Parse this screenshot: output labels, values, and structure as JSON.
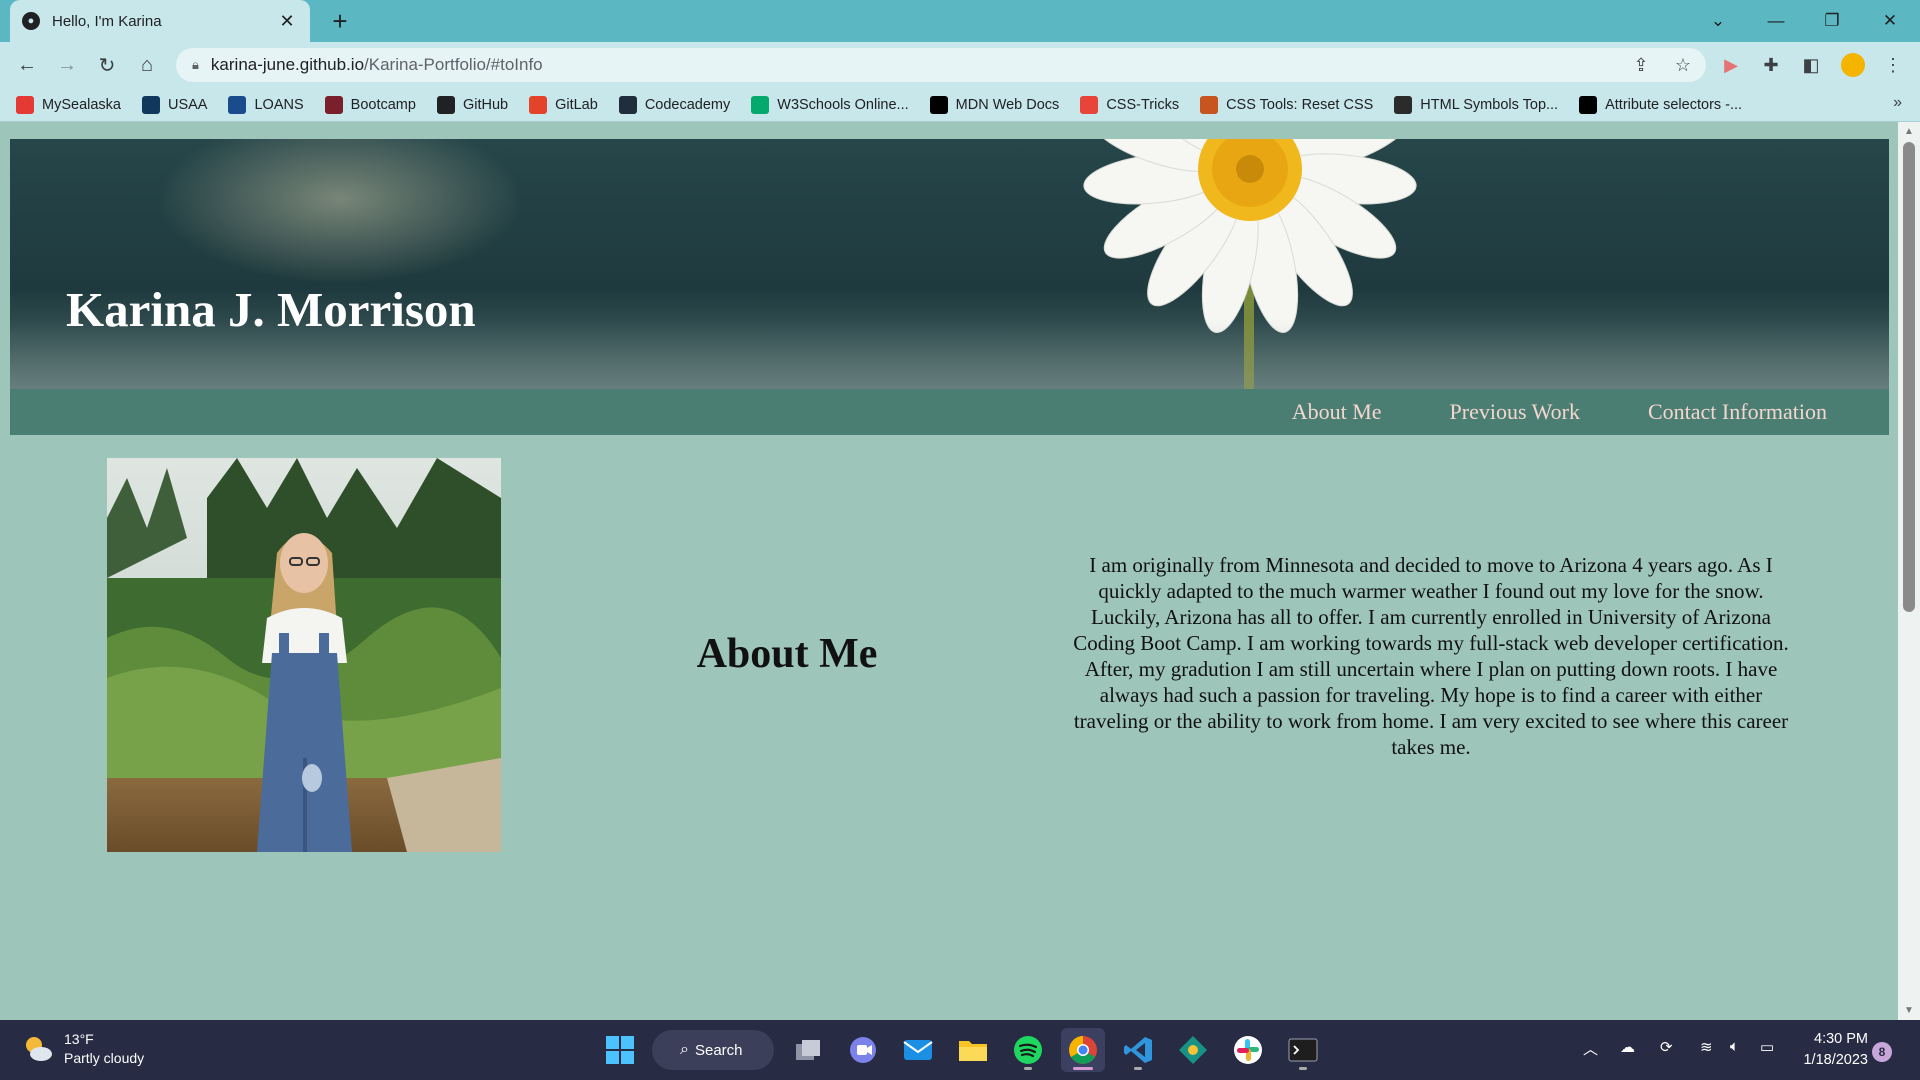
{
  "browser": {
    "tab_title": "Hello, I'm Karina",
    "url_host": "karina-june.github.io",
    "url_path": "/Karina-Portfolio/#toInfo",
    "bookmarks": [
      {
        "label": "MySealaska",
        "icon": "sealaska-icon",
        "color": "#e53935"
      },
      {
        "label": "USAA",
        "icon": "usaa-icon",
        "color": "#12375c"
      },
      {
        "label": "LOANS",
        "icon": "loans-icon",
        "color": "#1a4b8c"
      },
      {
        "label": "Bootcamp",
        "icon": "bootcamp-icon",
        "color": "#7a1f2b"
      },
      {
        "label": "GitHub",
        "icon": "github-icon",
        "color": "#202124"
      },
      {
        "label": "GitLab",
        "icon": "gitlab-icon",
        "color": "#e24329"
      },
      {
        "label": "Codecademy",
        "icon": "codecademy-icon",
        "color": "#1f2d3d"
      },
      {
        "label": "W3Schools Online...",
        "icon": "w3schools-icon",
        "color": "#04aa6d"
      },
      {
        "label": "MDN Web Docs",
        "icon": "mdn-icon",
        "color": "#000000"
      },
      {
        "label": "CSS-Tricks",
        "icon": "css-tricks-icon",
        "color": "#e8443a"
      },
      {
        "label": "CSS Tools: Reset CSS",
        "icon": "css-tools-icon",
        "color": "#c8541f"
      },
      {
        "label": "HTML Symbols Top...",
        "icon": "html-symbols-icon",
        "color": "#2b2b2b"
      },
      {
        "label": "Attribute selectors -...",
        "icon": "mdn-icon",
        "color": "#000000"
      }
    ]
  },
  "site": {
    "name": "Karina J. Morrison",
    "nav": [
      "About Me",
      "Previous Work",
      "Contact Information"
    ],
    "about_heading": "About Me",
    "about_text": "I am originally from Minnesota and decided to move to Arizona 4 years ago. As I quickly adapted to the much warmer weather I found out my love for the snow. Luckily, Arizona has all to offer. I am currently enrolled in University of Arizona Coding Boot Camp. I am working towards my full-stack web developer certification. After, my gradution I am still uncertain where I plan on putting down roots. I have always had such a passion for traveling. My hope is to find a career with either traveling or the ability to work from home. I am very excited to see where this career takes me."
  },
  "taskbar": {
    "weather_temp": "13°F",
    "weather_desc": "Partly cloudy",
    "search_label": "Search",
    "time": "4:30 PM",
    "date": "1/18/2023",
    "notification_count": "8"
  },
  "colors": {
    "page_bg": "#9dc5b9",
    "nav_bg": "#4a7e72",
    "nav_link": "#f4d6d0",
    "chrome": "#5bb8c3"
  }
}
